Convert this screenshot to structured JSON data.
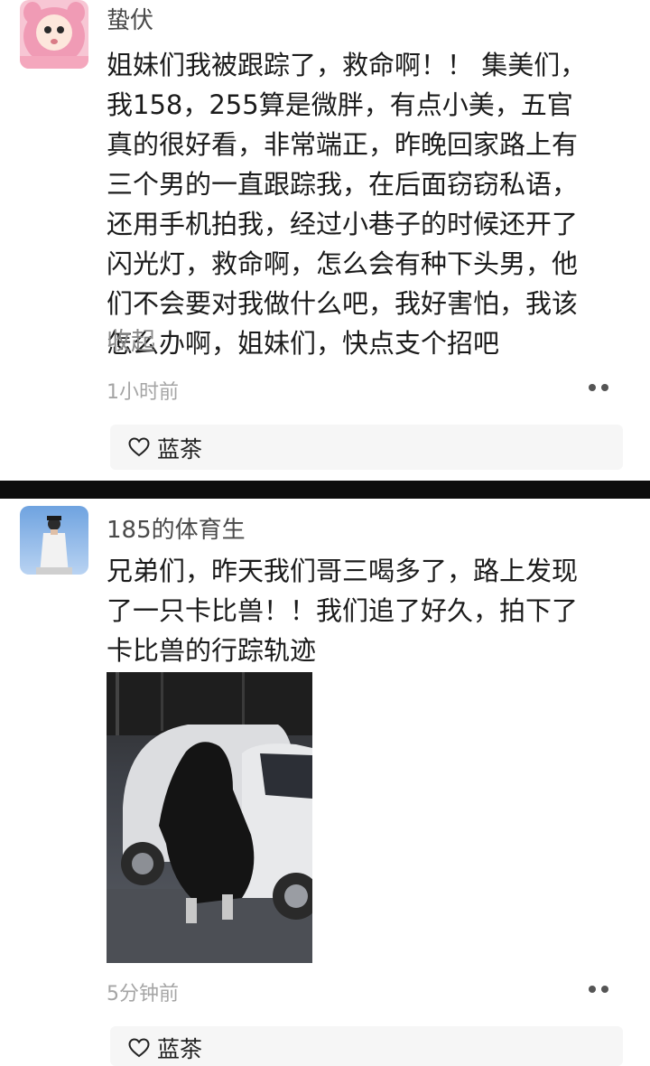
{
  "posts": [
    {
      "username": "蛰伏",
      "content_lines": [
        "姐妹们我被跟踪了，救命啊！！ 集美们，",
        "我158，255算是微胖，有点小美，五官",
        "真的很好看，非常端正，昨晚回家路上有",
        "三个男的一直跟踪我，在后面窃窃私语，",
        "还用手机拍我，经过小巷子的时候还开了",
        "闪光灯，救命啊，怎么会有种下头男，他",
        "们不会要对我做什么吧，我好害怕，我该",
        "怎么办啊，姐妹们，快点支个招吧"
      ],
      "collapse_label": "收起",
      "timestamp": "1小时前",
      "liker": "蓝茶",
      "icons": {
        "more": "more-dots-icon",
        "like": "heart-icon"
      }
    },
    {
      "username": "185的体育生",
      "content_lines": [
        "兄弟们，昨天我们哥三喝多了，路上发现",
        "了一只卡比兽！！我们追了好久，拍下了",
        "卡比兽的行踪轨迹"
      ],
      "timestamp": "5分钟前",
      "liker": "蓝茶",
      "icons": {
        "more": "more-dots-icon",
        "like": "heart-icon"
      }
    }
  ],
  "colors": {
    "divider": "#0d0d0d",
    "like_bar": "#f6f6f6",
    "avatar1_bg": "#f4b6c8",
    "avatar2_bg": "#8fb6e6"
  }
}
